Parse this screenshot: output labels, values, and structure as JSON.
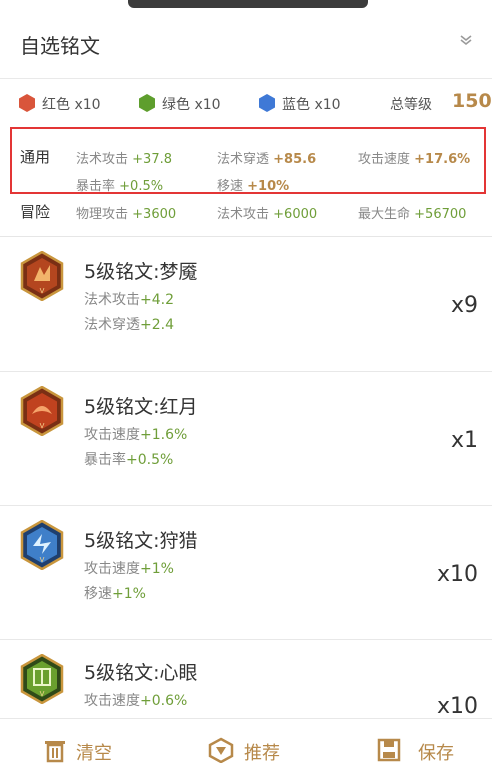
{
  "header": {
    "title": "自选铭文"
  },
  "colors": {
    "red": {
      "label": "红色 x10",
      "hex": "#d9553b"
    },
    "green": {
      "label": "绿色 x10",
      "hex": "#5e9e2d"
    },
    "blue": {
      "label": "蓝色 x10",
      "hex": "#3f79d6"
    },
    "total_label": "总等级",
    "total_value": "150"
  },
  "general": {
    "label": "通用",
    "stats": [
      {
        "name": "法术攻击",
        "value": "+37.8"
      },
      {
        "name": "法术穿透",
        "value": "+85.6"
      },
      {
        "name": "攻击速度",
        "value": "+17.6%"
      },
      {
        "name": "暴击率",
        "value": "+0.5%"
      },
      {
        "name": "移速",
        "value": "+10%"
      }
    ]
  },
  "adventure": {
    "label": "冒险",
    "stats": [
      {
        "name": "物理攻击",
        "value": "+3600"
      },
      {
        "name": "法术攻击",
        "value": "+6000"
      },
      {
        "name": "最大生命",
        "value": "+56700"
      }
    ]
  },
  "items": [
    {
      "name": "5级铭文:梦魇",
      "icon": "nightmare-rune-icon",
      "stats": [
        {
          "name": "法术攻击",
          "value": "+4.2"
        },
        {
          "name": "法术穿透",
          "value": "+2.4"
        }
      ],
      "count": "x9"
    },
    {
      "name": "5级铭文:红月",
      "icon": "red-moon-rune-icon",
      "stats": [
        {
          "name": "攻击速度",
          "value": "+1.6%"
        },
        {
          "name": "暴击率",
          "value": "+0.5%"
        }
      ],
      "count": "x1"
    },
    {
      "name": "5级铭文:狩猎",
      "icon": "hunt-rune-icon",
      "stats": [
        {
          "name": "攻击速度",
          "value": "+1%"
        },
        {
          "name": "移速",
          "value": "+1%"
        }
      ],
      "count": "x10"
    },
    {
      "name": "5级铭文:心眼",
      "icon": "mind-eye-rune-icon",
      "stats": [
        {
          "name": "攻击速度",
          "value": "+0.6%"
        }
      ],
      "count": "x10"
    }
  ],
  "footer": {
    "clear": "清空",
    "recommend": "推荐",
    "save": "保存"
  },
  "accent": "#b7894a",
  "stat_green": "#6f9e39"
}
